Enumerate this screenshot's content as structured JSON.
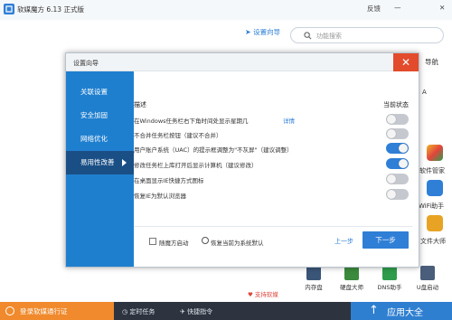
{
  "app": {
    "title": "软媒魔方 6.13 正式版",
    "feedback": "反馈",
    "minimize": "—",
    "close": "✕",
    "wizard_link": "设置向导",
    "search_placeholder": "功能搜索"
  },
  "peek": {
    "nav": "导航",
    "manager": "软件管家",
    "wifi": "WiFi助手",
    "files": "文件大师",
    "letter": "A"
  },
  "bottom_icons": [
    {
      "label": "内存盘",
      "color": "#3a5578"
    },
    {
      "label": "硬盘大师",
      "color": "#3b8a3d"
    },
    {
      "label": "DNS助手",
      "color": "#2e9c4b"
    },
    {
      "label": "U盘启动",
      "color": "#4a5d7a"
    }
  ],
  "support_label": "支持软媒",
  "bottombar": {
    "login": "登录软媒通行证",
    "timer": "定时任务",
    "shortcut": "快捷指令",
    "appstore": "应用大全"
  },
  "dialog": {
    "title": "设置向导",
    "close": "✕",
    "nav": [
      {
        "label": "关联设置",
        "active": false
      },
      {
        "label": "安全加固",
        "active": false
      },
      {
        "label": "网络优化",
        "active": false
      },
      {
        "label": "易用性改善",
        "active": true
      }
    ],
    "header_desc": "描述",
    "header_status": "当前状态",
    "rows": [
      {
        "label": "在Windows任务栏右下角时间处显示星期几",
        "detail": "详情",
        "on": false
      },
      {
        "label": "不合并任务栏按钮（建议不合并）",
        "detail": "",
        "on": false
      },
      {
        "label": "用户账户系统（UAC）的提示框调整为\"不灰屏\"（建议调整）",
        "detail": "",
        "on": true
      },
      {
        "label": "修改任务栏上库打开后显示计算机（建议修改）",
        "detail": "",
        "on": true
      },
      {
        "label": "在桌面显示IE快捷方式图标",
        "detail": "",
        "on": false
      },
      {
        "label": "恢复IE为默认浏览器",
        "detail": "",
        "on": false
      }
    ],
    "autostart_label": "随魔方启动",
    "reset_label": "恢复当前为系统默认",
    "prev_label": "上一步",
    "next_label": "下一步"
  }
}
